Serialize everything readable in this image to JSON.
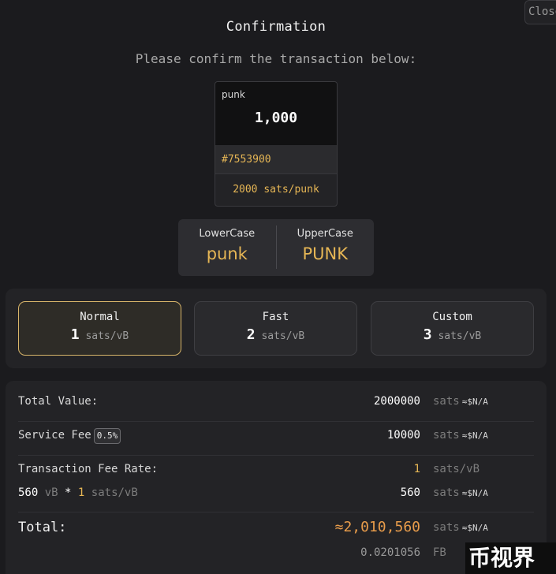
{
  "header": {
    "close_label": "Close",
    "title": "Confirmation",
    "subtitle": "Please confirm the transaction below:"
  },
  "token": {
    "ticker": "punk",
    "amount": "1,000",
    "inscription": "#7553900",
    "price": "2000 sats/punk"
  },
  "case": {
    "lower_label": "LowerCase",
    "lower_value": "punk",
    "upper_label": "UpperCase",
    "upper_value": "PUNK"
  },
  "fees": {
    "options": [
      {
        "name": "Normal",
        "value": "1",
        "unit": "sats/vB",
        "selected": true
      },
      {
        "name": "Fast",
        "value": "2",
        "unit": "sats/vB",
        "selected": false
      },
      {
        "name": "Custom",
        "value": "3",
        "unit": "sats/vB",
        "selected": false
      }
    ]
  },
  "summary": {
    "total_value": {
      "label": "Total Value:",
      "amount": "2000000",
      "unit": "sats",
      "usd": "≈$N/A"
    },
    "service_fee": {
      "label": "Service Fee",
      "badge": "0.5%",
      "amount": "10000",
      "unit": "sats",
      "usd": "≈$N/A"
    },
    "fee_rate": {
      "label": "Transaction Fee Rate:",
      "amount": "1",
      "unit": "sats/vB"
    },
    "network_fee": {
      "size": "560",
      "size_unit": "vB",
      "op": "*",
      "rate": "1",
      "rate_unit": "sats/vB",
      "amount": "560",
      "unit": "sats",
      "usd": "≈$N/A"
    },
    "total": {
      "label": "Total:",
      "amount": "≈2,010,560",
      "unit": "sats",
      "usd": "≈$N/A",
      "fb_amount": "0.0201056",
      "fb_unit": "FB"
    }
  },
  "watermark": {
    "text": "币视界"
  },
  "colors": {
    "accent": "#e6b655",
    "total": "#e89c4b",
    "background": "#1b1b1e"
  }
}
